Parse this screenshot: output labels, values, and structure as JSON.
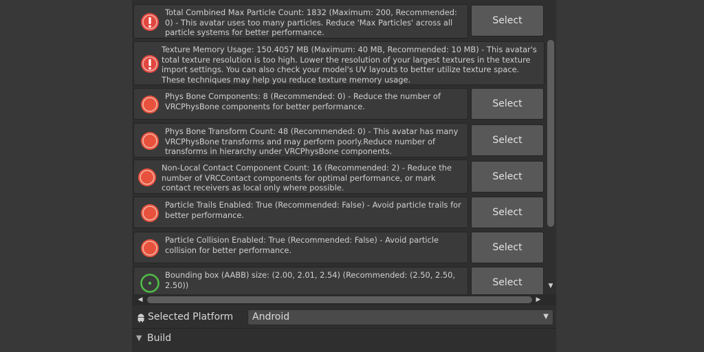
{
  "issues": [
    {
      "severity": "error",
      "icon": "error-exclamation-icon",
      "text": "Total Combined Max Particle Count: 1832 (Maximum: 200, Recommended: 0) - This avatar uses too many particles. Reduce 'Max Particles' across all particle systems for better performance.",
      "button": "Select"
    },
    {
      "severity": "error",
      "icon": "error-exclamation-icon",
      "text": "Texture Memory Usage: 150.4057 MB (Maximum: 40 MB, Recommended: 10 MB) - This avatar's total texture resolution is too high. Lower the resolution of your largest textures in the texture import settings. You can also check your model's UV layouts to better utilize texture space. These techniques may help you reduce texture memory usage.",
      "button": ""
    },
    {
      "severity": "poor",
      "icon": "poor-rating-icon",
      "text": "Phys Bone Components: 8 (Recommended: 0) - Reduce the number of VRCPhysBone components for better performance.",
      "button": "Select"
    },
    {
      "severity": "poor",
      "icon": "poor-rating-icon",
      "text": "Phys Bone Transform Count: 48 (Recommended: 0) - This avatar has many VRCPhysBone transforms and may perform poorly.Reduce number of transforms in hierarchy under VRCPhysBone components.",
      "button": "Select"
    },
    {
      "severity": "poor",
      "icon": "poor-rating-icon",
      "text": "Non-Local Contact Component Count: 16 (Recommended: 2) - Reduce the number of VRCContact components for optimal performance, or mark contact receivers as local only where possible.",
      "button": "Select"
    },
    {
      "severity": "poor",
      "icon": "poor-rating-icon",
      "text": "Particle Trails Enabled: True (Recommended: False) - Avoid particle trails for better performance.",
      "button": "Select"
    },
    {
      "severity": "poor",
      "icon": "poor-rating-icon",
      "text": "Particle Collision Enabled: True (Recommended: False) - Avoid particle collision for better performance.",
      "button": "Select"
    },
    {
      "severity": "good",
      "icon": "good-rating-icon",
      "text": "Bounding box (AABB) size: (2.00, 2.01, 2.54) (Recommended: (2.50, 2.50, 2.50))",
      "button": "Select"
    }
  ],
  "platform": {
    "label": "Selected Platform",
    "value": "Android",
    "icon": "android-icon"
  },
  "build": {
    "label": "Build",
    "icon": "foldout-collapsed-arrow-icon"
  },
  "colors": {
    "error": "#e2473f",
    "poor": "#e8523d",
    "good": "#4fbd45",
    "panel": "#2f2f2f",
    "button": "#585858"
  }
}
